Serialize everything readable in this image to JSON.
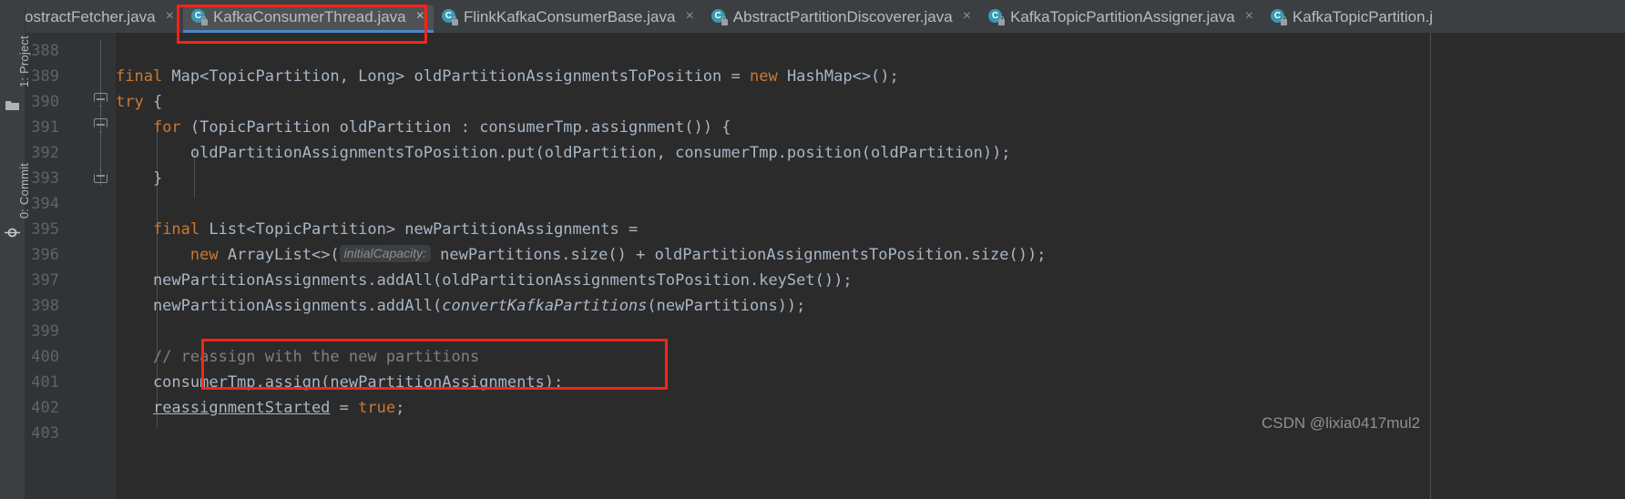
{
  "tool_stripe": {
    "project_label": "1: Project",
    "commit_label": "0: Commit",
    "folder_icon": "folder-icon",
    "commit_icon": "commit-icon"
  },
  "tabs": [
    {
      "label": "ostractFetcher.java",
      "icon": "java-class-icon",
      "icon_letter": "C",
      "close": "×",
      "active": false,
      "truncated_left": true
    },
    {
      "label": "KafkaConsumerThread.java",
      "icon": "java-class-icon",
      "icon_letter": "C",
      "close": "×",
      "active": true,
      "truncated_left": false
    },
    {
      "label": "FlinkKafkaConsumerBase.java",
      "icon": "java-class-icon",
      "icon_letter": "C",
      "close": "×",
      "active": false,
      "truncated_left": false
    },
    {
      "label": "AbstractPartitionDiscoverer.java",
      "icon": "java-class-icon",
      "icon_letter": "C",
      "close": "×",
      "active": false,
      "truncated_left": false
    },
    {
      "label": "KafkaTopicPartitionAssigner.java",
      "icon": "java-class-icon",
      "icon_letter": "C",
      "close": "×",
      "active": false,
      "truncated_left": false
    },
    {
      "label": "KafkaTopicPartition.j",
      "icon": "java-class-icon",
      "icon_letter": "C",
      "close": "",
      "active": false,
      "truncated_left": false
    }
  ],
  "editor": {
    "line_numbers": [
      "388",
      "389",
      "390",
      "391",
      "392",
      "393",
      "394",
      "395",
      "396",
      "397",
      "398",
      "399",
      "400",
      "401",
      "402",
      "403"
    ],
    "lines": [
      {
        "n": "388",
        "text": ""
      },
      {
        "n": "389",
        "text": "final Map<TopicPartition, Long> oldPartitionAssignmentsToPosition = new HashMap<>();"
      },
      {
        "n": "390",
        "text": "try {"
      },
      {
        "n": "391",
        "text": "    for (TopicPartition oldPartition : consumerTmp.assignment()) {"
      },
      {
        "n": "392",
        "text": "        oldPartitionAssignmentsToPosition.put(oldPartition, consumerTmp.position(oldPartition));"
      },
      {
        "n": "393",
        "text": "    }"
      },
      {
        "n": "394",
        "text": ""
      },
      {
        "n": "395",
        "text": "    final List<TopicPartition> newPartitionAssignments ="
      },
      {
        "n": "396",
        "text": "        new ArrayList<>( initialCapacity: newPartitions.size() + oldPartitionAssignmentsToPosition.size());"
      },
      {
        "n": "397",
        "text": "    newPartitionAssignments.addAll(oldPartitionAssignmentsToPosition.keySet());"
      },
      {
        "n": "398",
        "text": "    newPartitionAssignments.addAll(convertKafkaPartitions(newPartitions));"
      },
      {
        "n": "399",
        "text": ""
      },
      {
        "n": "400",
        "text": "    // reassign with the new partitions"
      },
      {
        "n": "401",
        "text": "    consumerTmp.assign(newPartitionAssignments);"
      },
      {
        "n": "402",
        "text": "    reassignmentStarted = true;"
      },
      {
        "n": "403",
        "text": ""
      }
    ],
    "param_hint": "initialCapacity:",
    "keywords": [
      "final",
      "try",
      "for",
      "new",
      "true"
    ],
    "comment_text": "// reassign with the new partitions"
  },
  "annotations": {
    "tab_highlight": "red-box-active-tab",
    "code_highlight": "red-box-reassign-code"
  },
  "watermark": "CSDN @lixia0417mul2",
  "colors": {
    "editor_background": "#2b2b2b",
    "gutter_background": "#313335",
    "tabbar_background": "#3c3f41",
    "active_tab_background": "#4e5254",
    "active_tab_underline": "#4a88c7",
    "keyword": "#cc7832",
    "identifier": "#a9b7c6",
    "comment": "#808080",
    "line_number": "#606366",
    "annotation_red": "#fb2318",
    "class_icon": "#389ab3"
  }
}
